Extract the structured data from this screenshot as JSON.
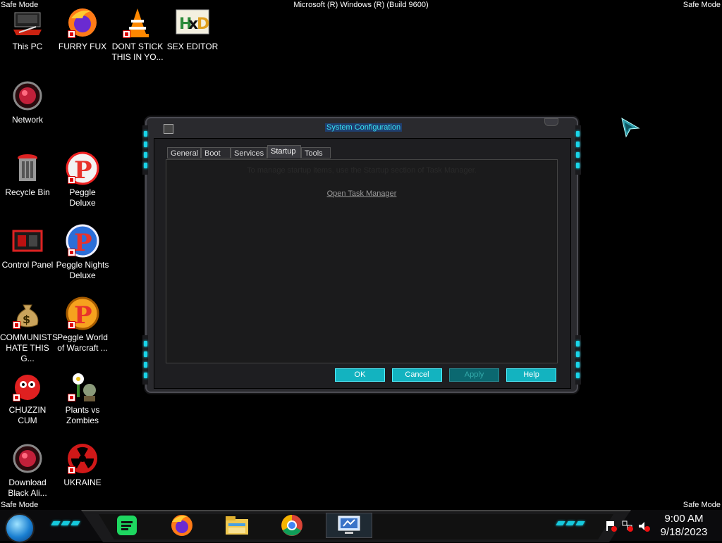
{
  "overlay": {
    "safe_mode": "Safe Mode",
    "build": "Microsoft (R) Windows (R) (Build 9600)"
  },
  "desktop": {
    "icons": [
      {
        "label": "This PC",
        "icon": "computer-icon"
      },
      {
        "label": "FURRY FUX",
        "icon": "firefox-icon"
      },
      {
        "label": "DONT STICK THIS IN YO...",
        "icon": "vlc-cone-icon"
      },
      {
        "label": "SEX EDITOR",
        "icon": "hxd-editor-icon"
      },
      {
        "label": "Network",
        "icon": "network-orb-icon"
      },
      {
        "label": "Recycle Bin",
        "icon": "recycle-bin-icon"
      },
      {
        "label": "Peggle Deluxe",
        "icon": "peggle-icon"
      },
      {
        "label": "Control Panel",
        "icon": "control-panel-icon"
      },
      {
        "label": "Peggle Nights Deluxe",
        "icon": "peggle-nights-icon"
      },
      {
        "label": "COMMUNISTS HATE THIS G...",
        "icon": "money-bag-icon"
      },
      {
        "label": "Peggle World of Warcraft ...",
        "icon": "peggle-wow-icon"
      },
      {
        "label": "CHUZZIN CUM",
        "icon": "chuzzle-icon"
      },
      {
        "label": "Plants vs Zombies",
        "icon": "plants-vs-zombies-icon"
      },
      {
        "label": "Download Black Ali...",
        "icon": "download-orb-icon"
      },
      {
        "label": "UKRAINE",
        "icon": "radiation-icon"
      }
    ]
  },
  "window": {
    "title": "System Configuration",
    "tabs": [
      "General",
      "Boot",
      "Services",
      "Startup",
      "Tools"
    ],
    "active_tab": "Startup",
    "message": "To manage startup items, use the Startup section of Task Manager.",
    "link": "Open Task Manager",
    "buttons": {
      "ok": "OK",
      "cancel": "Cancel",
      "apply": "Apply",
      "help": "Help"
    }
  },
  "taskbar": {
    "pinned": [
      "spotify-icon",
      "firefox-icon",
      "file-explorer-icon",
      "chrome-icon",
      "system-configuration-icon"
    ],
    "clock_time": "9:00 AM",
    "clock_date": "9/18/2023"
  },
  "colors": {
    "accent": "#19d4e8",
    "button": "#13b3c0",
    "frame": "#2a2a2e"
  }
}
